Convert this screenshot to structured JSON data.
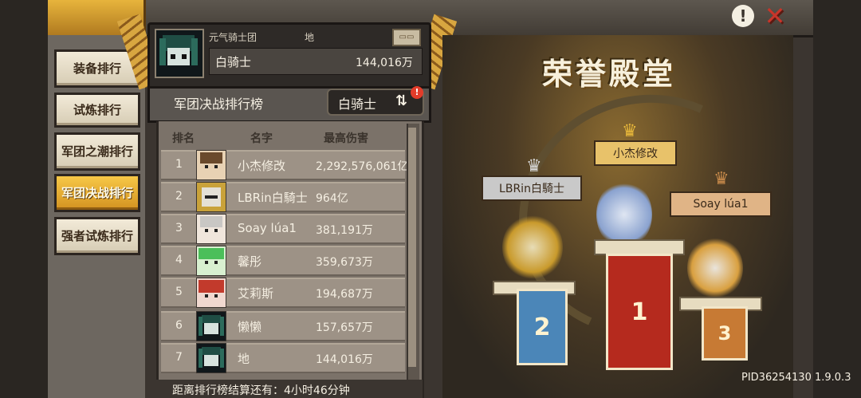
{
  "sidebar": {
    "items": [
      {
        "label": "装备排行",
        "active": false
      },
      {
        "label": "试炼排行",
        "active": false
      },
      {
        "label": "军团之潮排行",
        "active": false
      },
      {
        "label": "军团决战排行",
        "active": true
      },
      {
        "label": "强者试炼排行",
        "active": false
      }
    ]
  },
  "player": {
    "guild": "元气骑士团",
    "name_short": "地",
    "title": "白骑士",
    "damage": "144,016万"
  },
  "ranking": {
    "title": "军团决战排行榜",
    "filter": "白骑士",
    "alert": "!",
    "columns": {
      "rank": "排名",
      "name": "名字",
      "damage": "最高伤害"
    },
    "rows": [
      {
        "rank": "1",
        "name": "小杰修改",
        "damage": "2,292,576,061亿",
        "avatar": "brown-hair"
      },
      {
        "rank": "2",
        "name": "LBRin白騎士",
        "damage": "964亿",
        "avatar": "gold-knight"
      },
      {
        "rank": "3",
        "name": "Soay lúa1",
        "damage": "381,191万",
        "avatar": "white-hair"
      },
      {
        "rank": "4",
        "name": "馨彤",
        "damage": "359,673万",
        "avatar": "green-hair"
      },
      {
        "rank": "5",
        "name": "艾莉斯",
        "damage": "194,687万",
        "avatar": "red-hair"
      },
      {
        "rank": "6",
        "name": "懒懒",
        "damage": "157,657万",
        "avatar": "dark-teal"
      },
      {
        "rank": "7",
        "name": "地",
        "damage": "144,016万",
        "avatar": "dark-teal"
      }
    ],
    "footer": "距离排行榜结算还有：4小时46分钟"
  },
  "hall": {
    "title": "荣誉殿堂",
    "first": {
      "name": "小杰修改",
      "place": "1"
    },
    "second": {
      "name": "LBRin白騎士",
      "place": "2"
    },
    "third": {
      "name": "Soay lúa1",
      "place": "3"
    }
  },
  "icons": {
    "info": "!",
    "close": "✕",
    "swap": "⇅"
  },
  "pid": "PID36254130 1.9.0.3"
}
